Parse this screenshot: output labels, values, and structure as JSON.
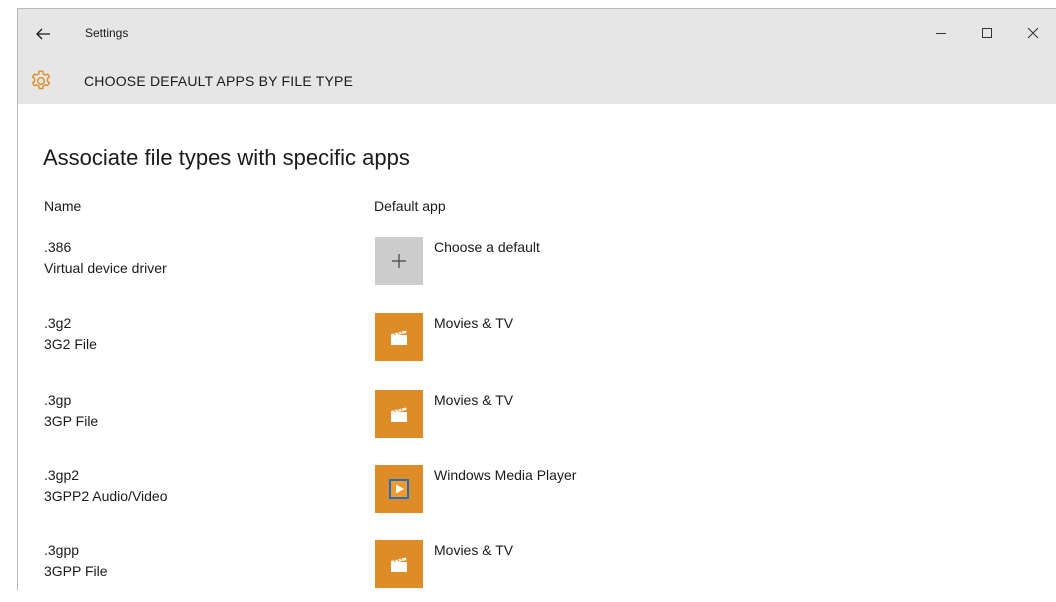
{
  "window": {
    "title": "Settings",
    "heading": "CHOOSE DEFAULT APPS BY FILE TYPE"
  },
  "main": {
    "section_title": "Associate file types with specific apps",
    "columns": {
      "name": "Name",
      "default_app": "Default app"
    },
    "rows": [
      {
        "ext": ".386",
        "desc": "Virtual device driver",
        "app": "Choose a default",
        "icon": "plus-icon"
      },
      {
        "ext": ".3g2",
        "desc": "3G2 File",
        "app": "Movies & TV",
        "icon": "movies-tv-icon"
      },
      {
        "ext": ".3gp",
        "desc": "3GP File",
        "app": "Movies & TV",
        "icon": "movies-tv-icon"
      },
      {
        "ext": ".3gp2",
        "desc": "3GPP2 Audio/Video",
        "app": "Windows Media Player",
        "icon": "windows-media-player-icon"
      },
      {
        "ext": ".3gpp",
        "desc": "3GPP File",
        "app": "Movies & TV",
        "icon": "movies-tv-icon"
      }
    ]
  },
  "colors": {
    "titlebar_bg": "#e6e6e6",
    "accent_orange": "#dd8c28",
    "tile_gray": "#cdcdcd"
  }
}
